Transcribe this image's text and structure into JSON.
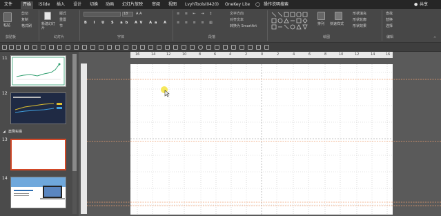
{
  "tabs": [
    "文件",
    "开始",
    "iSlide",
    "插入",
    "设计",
    "切换",
    "动画",
    "幻灯片放映",
    "审阅",
    "视图",
    "LvyhTools(0420)",
    "OneKey Lite"
  ],
  "active_tab": "开始",
  "tell_me": "操作说明搜索",
  "share": "共享",
  "ribbon": {
    "paste": "粘贴",
    "cut": "剪切",
    "copy": "复制",
    "format_painter": "格式刷",
    "new_slide": "新建幻灯片",
    "layout": "版式",
    "reset": "重置",
    "section": "节",
    "font_size": "18",
    "text_direction": "文字方向",
    "align_text": "对齐文本",
    "smartart": "转换为 SmartArt",
    "arrange": "排列",
    "quick_styles": "快速样式",
    "shape_fill": "形状填充",
    "shape_outline": "形状轮廓",
    "shape_effects": "形状效果",
    "find": "查找",
    "replace": "替换",
    "select": "选择",
    "groups": {
      "clipboard": "剪贴板",
      "slides": "幻灯片",
      "font": "字体",
      "paragraph": "段落",
      "drawing": "绘图",
      "editing": "编辑"
    }
  },
  "slides": [
    {
      "num": "11",
      "kind": "chart-white"
    },
    {
      "num": "12",
      "kind": "chart-dark"
    },
    {
      "num": "13",
      "kind": "blank",
      "selected": true
    },
    {
      "num": "14",
      "kind": "photo"
    }
  ],
  "section_label": "案例实操",
  "ruler_labels": [
    "16",
    "14",
    "12",
    "10",
    "8",
    "6",
    "4",
    "2",
    "0",
    "2",
    "4",
    "6",
    "8",
    "10",
    "12",
    "14",
    "16"
  ],
  "colors": {
    "accent": "#d24726",
    "guide": "#f0a070"
  }
}
